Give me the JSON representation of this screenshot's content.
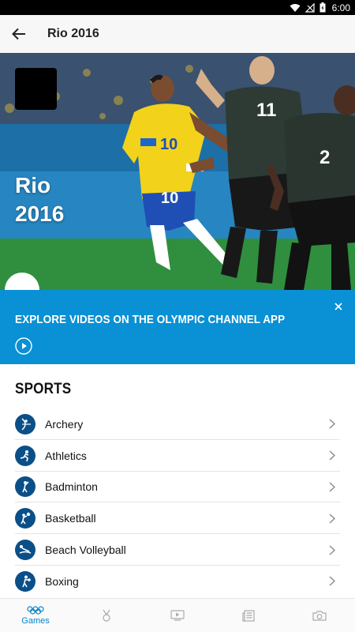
{
  "status_bar": {
    "time": "6:00"
  },
  "app_bar": {
    "title": "Rio 2016"
  },
  "hero": {
    "title_line1": "Rio",
    "title_line2": "2016"
  },
  "banner": {
    "text": "EXPLORE VIDEOS ON THE OLYMPIC CHANNEL APP"
  },
  "sports": {
    "heading": "SPORTS",
    "items": [
      {
        "label": "Archery",
        "icon": "archery-icon"
      },
      {
        "label": "Athletics",
        "icon": "athletics-icon"
      },
      {
        "label": "Badminton",
        "icon": "badminton-icon"
      },
      {
        "label": "Basketball",
        "icon": "basketball-icon"
      },
      {
        "label": "Beach Volleyball",
        "icon": "beach-volleyball-icon"
      },
      {
        "label": "Boxing",
        "icon": "boxing-icon"
      }
    ]
  },
  "bottom_nav": {
    "items": [
      {
        "label": "Games",
        "icon": "olympic-rings-icon",
        "active": true
      },
      {
        "label": "",
        "icon": "medal-icon",
        "active": false
      },
      {
        "label": "",
        "icon": "video-icon",
        "active": false
      },
      {
        "label": "",
        "icon": "news-icon",
        "active": false
      },
      {
        "label": "",
        "icon": "camera-icon",
        "active": false
      }
    ]
  },
  "colors": {
    "accent": "#0a90d4",
    "sport_icon": "#0b4f88",
    "nav_active": "#0a85c9"
  }
}
